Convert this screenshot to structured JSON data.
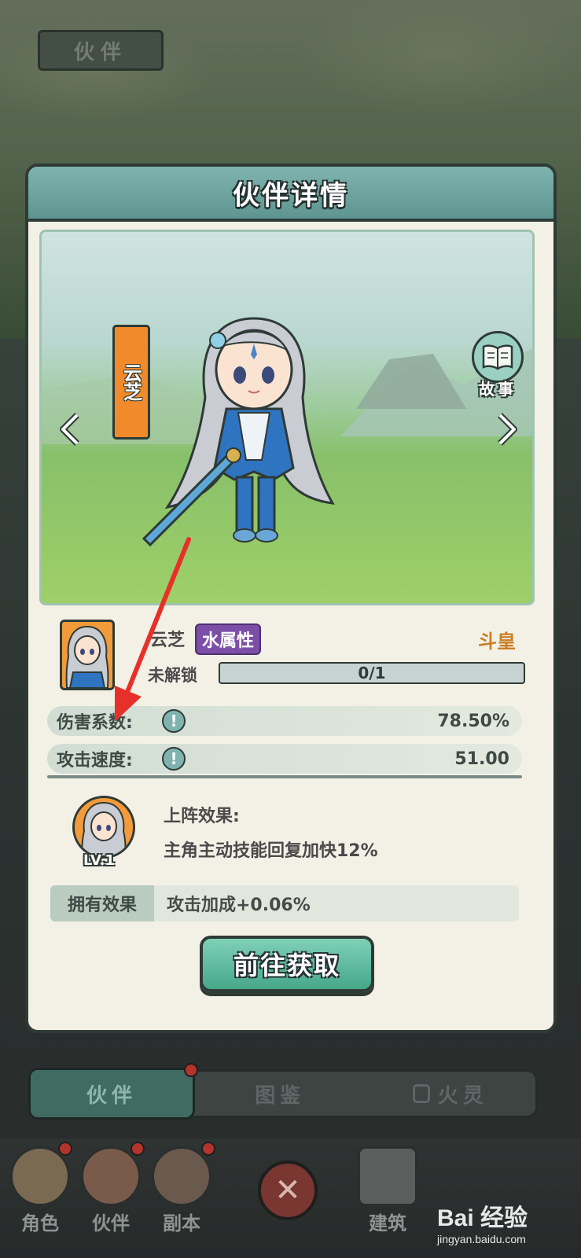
{
  "background": {
    "title": "伙伴"
  },
  "modal": {
    "title": "伙伴详情",
    "character_banner": "云芝",
    "story_button": "故事",
    "character": {
      "name": "云芝",
      "attribute": "水属性",
      "rank": "斗皇",
      "unlock_label": "未解锁",
      "progress_text": "0/1",
      "progress_fraction": 0
    },
    "stats": [
      {
        "label": "伤害系数:",
        "value": "78.50%"
      },
      {
        "label": "攻击速度:",
        "value": "51.00"
      }
    ],
    "deploy": {
      "level": "LV.1",
      "title": "上阵效果:",
      "description": "主角主动技能回复加快12%"
    },
    "own_effect": {
      "label": "拥有效果",
      "value": "攻击加成+0.06%"
    },
    "go_button": "前往获取"
  },
  "tabs": [
    {
      "label": "伙伴",
      "active": true
    },
    {
      "label": "图鉴",
      "active": false
    },
    {
      "label": "火灵",
      "active": false
    }
  ],
  "bottom_nav": [
    {
      "label": "角色"
    },
    {
      "label": "伙伴"
    },
    {
      "label": "副本"
    },
    {
      "label": "建筑"
    }
  ],
  "watermark": {
    "main": "Bai 经验",
    "sub": "jingyan.baidu.com"
  },
  "colors": {
    "accent_teal": "#7fb3b0",
    "orange": "#f08a2b",
    "purple_badge": "#7b4fa8",
    "rank_gold": "#c97f26",
    "annotation_red": "#e8302a"
  }
}
